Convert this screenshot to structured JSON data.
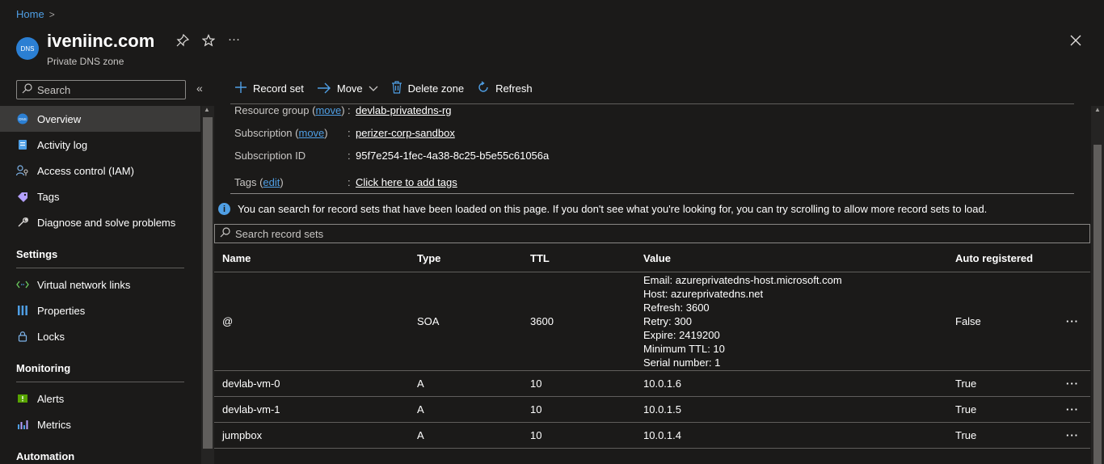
{
  "breadcrumb": {
    "home": "Home",
    "separator": ">"
  },
  "header": {
    "badge": "DNS",
    "title": "iveniinc.com",
    "subtitle": "Private DNS zone",
    "more": "···"
  },
  "sidebar": {
    "search_placeholder": "Search",
    "items": [
      {
        "label": "Overview",
        "icon": "dns-icon"
      },
      {
        "label": "Activity log",
        "icon": "activity-log-icon"
      },
      {
        "label": "Access control (IAM)",
        "icon": "iam-icon"
      },
      {
        "label": "Tags",
        "icon": "tag-icon"
      },
      {
        "label": "Diagnose and solve problems",
        "icon": "wrench-icon"
      }
    ],
    "sections": {
      "settings": {
        "title": "Settings",
        "items": [
          {
            "label": "Virtual network links",
            "icon": "link-icon"
          },
          {
            "label": "Properties",
            "icon": "properties-icon"
          },
          {
            "label": "Locks",
            "icon": "lock-icon"
          }
        ]
      },
      "monitoring": {
        "title": "Monitoring",
        "items": [
          {
            "label": "Alerts",
            "icon": "alert-icon"
          },
          {
            "label": "Metrics",
            "icon": "metrics-icon"
          }
        ]
      },
      "automation": {
        "title": "Automation"
      }
    }
  },
  "toolbar": {
    "record_set": "Record set",
    "move": "Move",
    "delete_zone": "Delete zone",
    "refresh": "Refresh"
  },
  "essentials": {
    "resource_group": {
      "label": "Resource group",
      "action": "move",
      "value": "devlab-privatedns-rg"
    },
    "subscription": {
      "label": "Subscription",
      "action": "move",
      "value": "perizer-corp-sandbox"
    },
    "subscription_id": {
      "label": "Subscription ID",
      "value": "95f7e254-1fec-4a38-8c25-b5e55c61056a"
    },
    "tags": {
      "label": "Tags",
      "action": "edit",
      "value": "Click here to add tags"
    }
  },
  "info_message": "You can search for record sets that have been loaded on this page. If you don't see what you're looking for, you can try scrolling to allow more record sets to load.",
  "record_search_placeholder": "Search record sets",
  "table": {
    "columns": [
      "Name",
      "Type",
      "TTL",
      "Value",
      "Auto registered"
    ],
    "rows": [
      {
        "name": "@",
        "type": "SOA",
        "ttl": "3600",
        "value": [
          "Email: azureprivatedns-host.microsoft.com",
          "Host: azureprivatedns.net",
          "Refresh: 3600",
          "Retry: 300",
          "Expire: 2419200",
          "Minimum TTL: 10",
          "Serial number: 1"
        ],
        "auto": "False"
      },
      {
        "name": "devlab-vm-0",
        "type": "A",
        "ttl": "10",
        "value": [
          "10.0.1.6"
        ],
        "auto": "True"
      },
      {
        "name": "devlab-vm-1",
        "type": "A",
        "ttl": "10",
        "value": [
          "10.0.1.5"
        ],
        "auto": "True"
      },
      {
        "name": "jumpbox",
        "type": "A",
        "ttl": "10",
        "value": [
          "10.0.1.4"
        ],
        "auto": "True"
      }
    ],
    "row_more": "···"
  }
}
